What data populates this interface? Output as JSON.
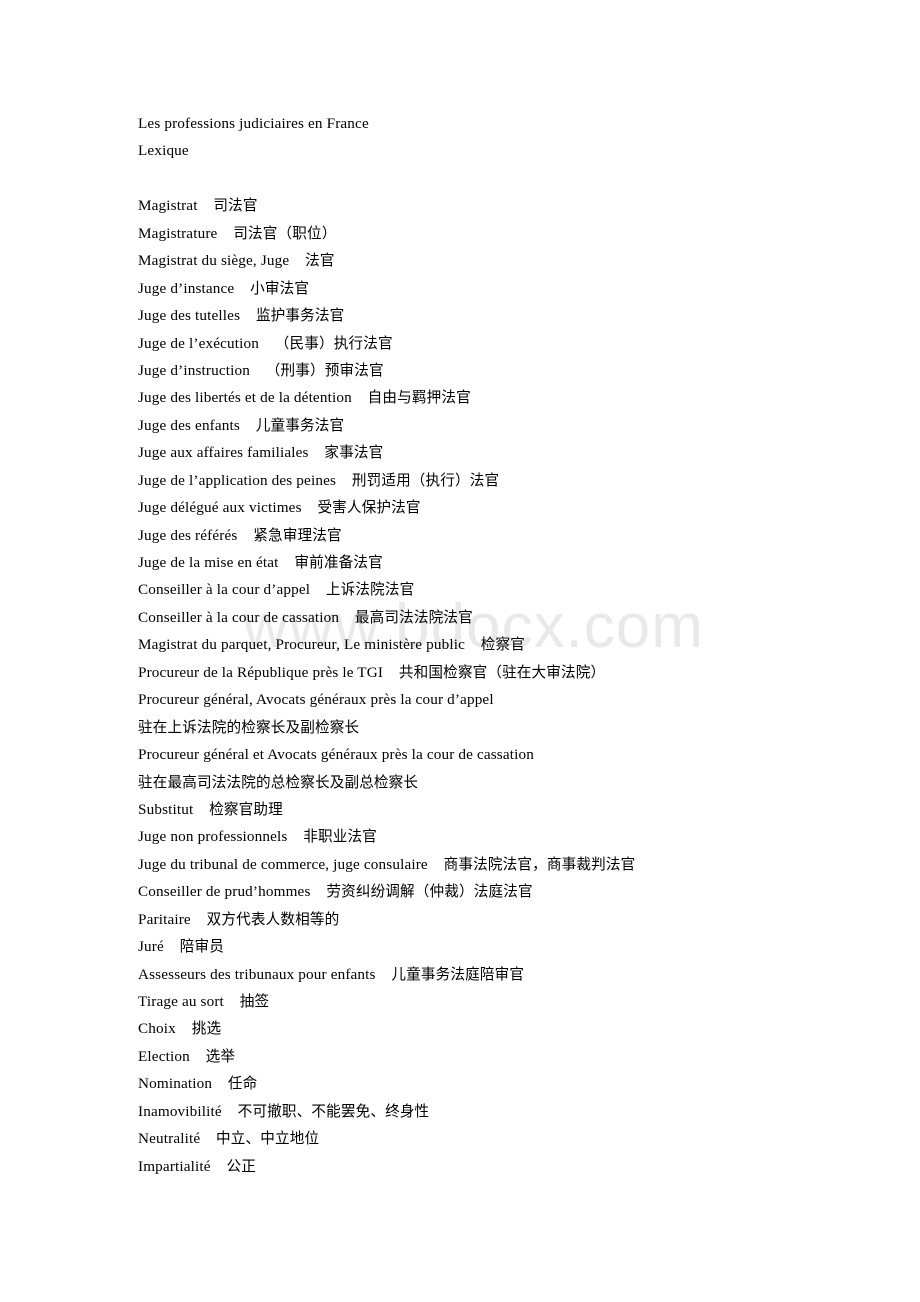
{
  "document": {
    "title_lines": [
      "Les professions judiciaires en France",
      "Lexique"
    ],
    "watermark": "www.bdocx.com",
    "watermark_color": "#e9e9e9",
    "text_color": "#000000",
    "background_color": "#ffffff"
  },
  "glossary": {
    "separator": "    ",
    "entries": [
      {
        "term": "Magistrat",
        "translation": "司法官",
        "wrapped": false
      },
      {
        "term": "Magistrature",
        "translation": "司法官（职位）",
        "wrapped": false
      },
      {
        "term": "Magistrat du siège, Juge",
        "translation": "法官",
        "wrapped": false
      },
      {
        "term": "Juge d’instance",
        "translation": "小审法官",
        "wrapped": false
      },
      {
        "term": "Juge des tutelles",
        "translation": "监护事务法官",
        "wrapped": false
      },
      {
        "term": "Juge de l’exécution",
        "translation": "（民事）执行法官",
        "wrapped": false
      },
      {
        "term": "Juge d’instruction",
        "translation": "（刑事）预审法官",
        "wrapped": false
      },
      {
        "term": "Juge des libertés et de la détention",
        "translation": "自由与羁押法官",
        "wrapped": false
      },
      {
        "term": "Juge des enfants",
        "translation": "儿童事务法官",
        "wrapped": false
      },
      {
        "term": "Juge aux affaires familiales",
        "translation": "家事法官",
        "wrapped": false
      },
      {
        "term": "Juge de l’application des peines",
        "translation": "刑罚适用（执行）法官",
        "wrapped": false
      },
      {
        "term": "Juge délégué aux victimes",
        "translation": "受害人保护法官",
        "wrapped": false
      },
      {
        "term": "Juge des référés",
        "translation": "紧急审理法官",
        "wrapped": false
      },
      {
        "term": "Juge de la mise en état",
        "translation": "审前准备法官",
        "wrapped": false
      },
      {
        "term": "Conseiller à la cour d’appel",
        "translation": "上诉法院法官",
        "wrapped": false
      },
      {
        "term": "Conseiller à la cour de cassation",
        "translation": "最高司法法院法官",
        "wrapped": false
      },
      {
        "term": "Magistrat du parquet, Procureur, Le ministère public",
        "translation": "检察官",
        "wrapped": false
      },
      {
        "term": "Procureur de la République près le TGI",
        "translation": "共和国检察官（驻在大审法院）",
        "wrapped": false
      },
      {
        "term": "Procureur général, Avocats généraux près la cour d’appel",
        "translation": "驻在上诉法院的检察长及副检察长",
        "wrapped": true
      },
      {
        "term": "Procureur général et Avocats généraux près la cour de cassation",
        "translation": "驻在最高司法法院的总检察长及副总检察长",
        "wrapped": true
      },
      {
        "term": "Substitut",
        "translation": "检察官助理",
        "wrapped": false
      },
      {
        "term": "Juge non professionnels",
        "translation": "非职业法官",
        "wrapped": false
      },
      {
        "term": "Juge du tribunal de commerce, juge consulaire",
        "translation": "商事法院法官，商事裁判法官",
        "wrapped": false
      },
      {
        "term": "Conseiller de prud’hommes",
        "translation": "劳资纠纷调解（仲裁）法庭法官",
        "wrapped": false
      },
      {
        "term": "Paritaire",
        "translation": "双方代表人数相等的",
        "wrapped": false
      },
      {
        "term": "Juré",
        "translation": "陪审员",
        "wrapped": false
      },
      {
        "term": "Assesseurs des tribunaux pour enfants",
        "translation": "儿童事务法庭陪审官",
        "wrapped": false
      },
      {
        "term": "Tirage au sort",
        "translation": "抽签",
        "wrapped": false
      },
      {
        "term": "Choix",
        "translation": "挑选",
        "wrapped": false
      },
      {
        "term": "Election",
        "translation": "选举",
        "wrapped": false
      },
      {
        "term": "Nomination",
        "translation": "任命",
        "wrapped": false
      },
      {
        "term": "Inamovibilité",
        "translation": "不可撤职、不能罢免、终身性",
        "wrapped": false
      },
      {
        "term": "Neutralité",
        "translation": "中立、中立地位",
        "wrapped": false
      },
      {
        "term": "Impartialité",
        "translation": "公正",
        "wrapped": false
      }
    ]
  }
}
